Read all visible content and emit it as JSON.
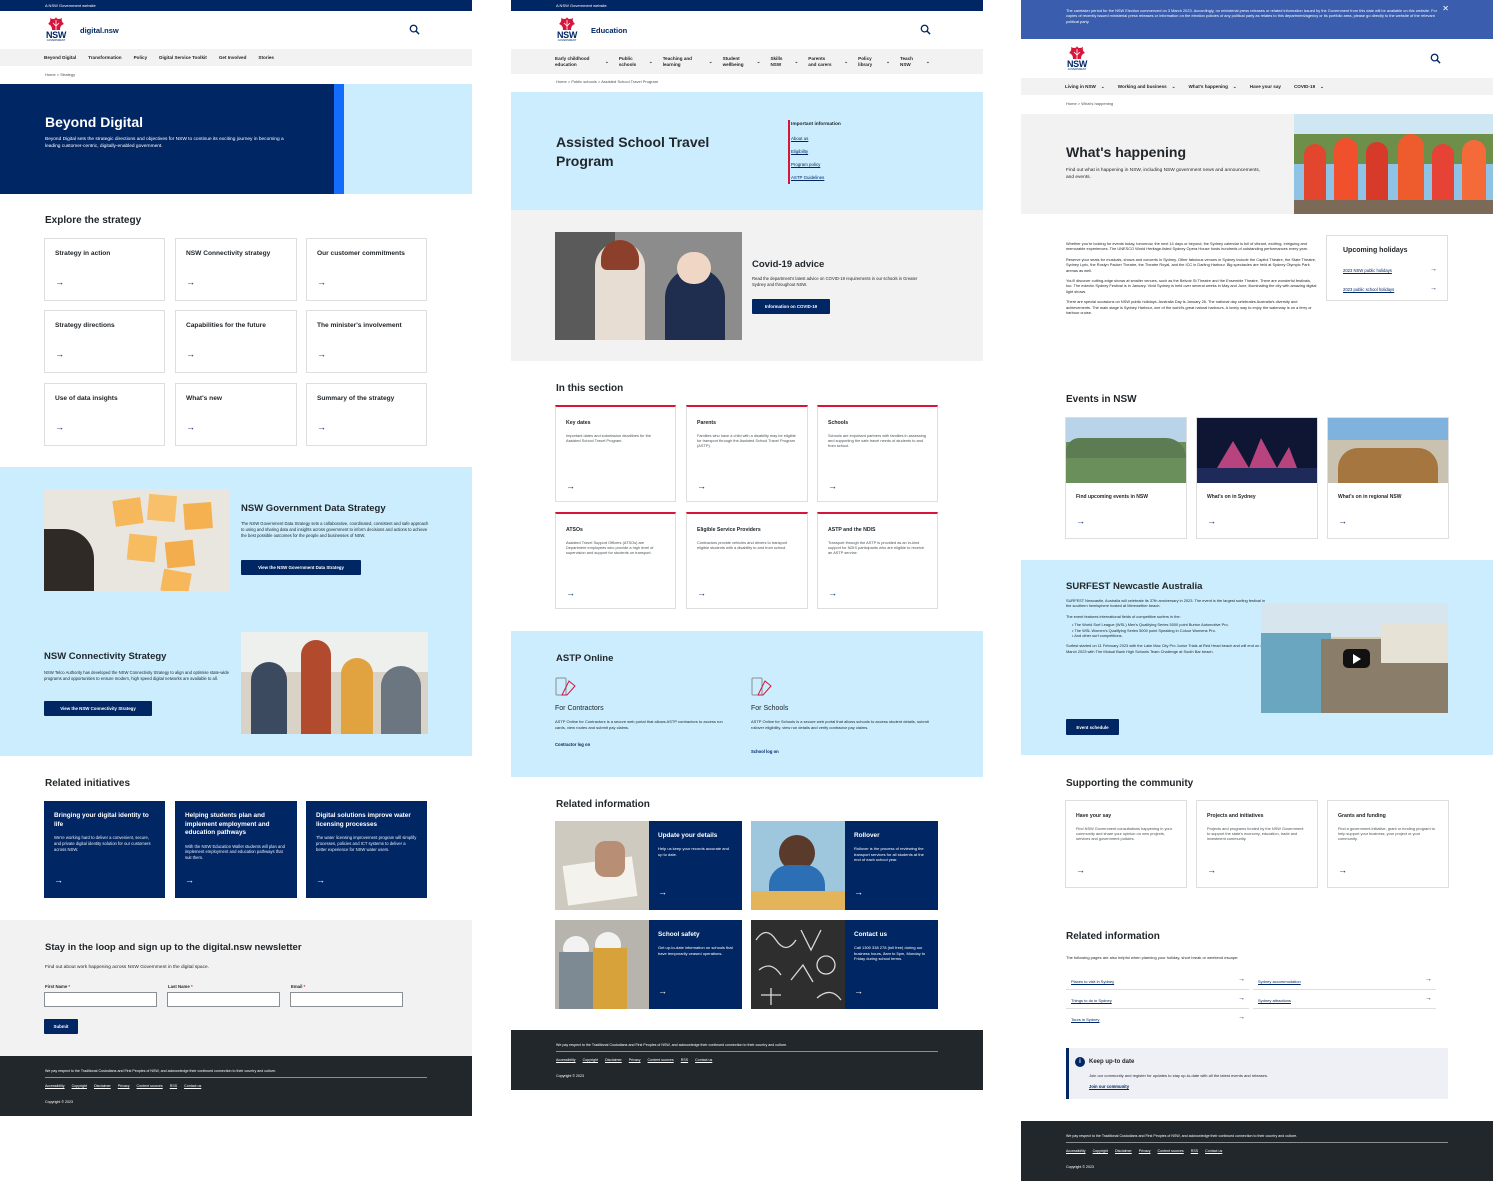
{
  "c1": {
    "masthead": "A NSW Government website",
    "logo": {
      "nsw": "NSW",
      "gov": "GOVERNMENT"
    },
    "site": "digital.nsw",
    "nav": [
      "Beyond Digital",
      "Transformation",
      "Policy",
      "Digital Service Toolkit",
      "Get Involved",
      "Stories"
    ],
    "crumb": "Home  >  Strategy",
    "hero": {
      "title": "Beyond Digital",
      "text": "Beyond Digital sets the strategic directions and objectives for NSW to continue its exciting journey in becoming a leading customer-centric, digitally-enabled government."
    },
    "explore_title": "Explore the strategy",
    "explore": [
      "Strategy in action",
      "NSW Connectivity strategy",
      "Our customer commitments",
      "Strategy directions",
      "Capabilities for the future",
      "The minister's involvement",
      "Use of data insights",
      "What's new",
      "Summary of the strategy"
    ],
    "data_strategy": {
      "title": "NSW Government Data Strategy",
      "text": "The NSW Government Data Strategy sets a collaborative, coordinated, consistent and safe approach to using and sharing data and insights across government to inform decisions and actions to achieve the best possible outcomes for the people and businesses of NSW.",
      "button": "View the NSW Government Data Strategy"
    },
    "connectivity": {
      "title": "NSW Connectivity Strategy",
      "text": "NSW Telco Authority has developed the NSW Connectivity Strategy to align and optimise state-wide programs and opportunities to ensure modern, high speed digital networks are available to all.",
      "button": "View the NSW Connectivity Strategy"
    },
    "related_title": "Related initiatives",
    "related": [
      {
        "title": "Bringing your digital identity to life",
        "text": "We're working hard to deliver a convenient, secure, and private digital identity solution for our customers across NSW."
      },
      {
        "title": "Helping students plan and implement employment and education pathways",
        "text": "With the NSW Education Wallet students will plan and implement employment and education pathways that suit them."
      },
      {
        "title": "Digital solutions improve water licensing processes",
        "text": "The water licensing improvement program will simplify processes, policies and ICT systems to deliver a better experience for NSW water users."
      }
    ],
    "newsletter": {
      "title": "Stay in the loop and sign up to the digital.nsw newsletter",
      "text": "Find out about work happening across NSW Government in the digital space.",
      "first": "First Name",
      "last": "Last Name",
      "email": "Email",
      "req": "*",
      "submit": "Submit"
    },
    "footer": {
      "ack": "We pay respect to the Traditional Custodians and First Peoples of NSW, and acknowledge their continued connection to their country and culture.",
      "links": [
        "Accessibility",
        "Copyright",
        "Disclaimer",
        "Privacy",
        "Content sources",
        "RSS",
        "Contact us"
      ],
      "copy": "Copyright © 2023"
    }
  },
  "c2": {
    "masthead": "A NSW Government website",
    "logo": {
      "nsw": "NSW",
      "gov": "GOVERNMENT"
    },
    "site": "Education",
    "nav": [
      "Early childhood education",
      "Public schools",
      "Teaching and learning",
      "Student wellbeing",
      "Skills NSW",
      "Parents and carers",
      "Policy library",
      "Teach NSW"
    ],
    "crumb": "Home  >  Public schools  >  Assisted School Travel Program",
    "hero": {
      "title": "Assisted School Travel Program",
      "info_title": "Important information",
      "info_links": [
        "About us",
        "Eligibility",
        "Program policy",
        "ASTP Guidelines"
      ]
    },
    "covid": {
      "title": "Covid-19 advice",
      "text": "Read the department's latest advice on COVID-19 requirements in our schools in Greater Sydney and throughout NSW.",
      "button": "Information on COVID-19"
    },
    "section_title": "In this section",
    "section": [
      {
        "title": "Key dates",
        "text": "Important dates and submission deadlines for the Assisted School Travel Program."
      },
      {
        "title": "Parents",
        "text": "Families who have a child with a disability may be eligible for transport through the Assisted School Travel Program (ASTP)."
      },
      {
        "title": "Schools",
        "text": "Schools are important partners with families in assessing and supporting the safe travel needs of students to and from school."
      },
      {
        "title": "ATSOs",
        "text": "Assisted Travel Support Officers (ATSOs) are Department employees who provide a high level of supervision and support for students on transport."
      },
      {
        "title": "Eligible Service Providers",
        "text": "Contractors provide vehicles and drivers to transport eligible students with a disability to and from school."
      },
      {
        "title": "ASTP and the NDIS",
        "text": "Transport through the ASTP is provided as an in-kind support for NDIS participants who are eligible to receive an ASTP service."
      }
    ],
    "astp": {
      "title": "ASTP Online",
      "a_title": "For Contractors",
      "a_text": "ASTP Online for Contractors is a secure web portal that allows ASTP contractors to access run cards, view routes and submit pay claims.",
      "a_link": "Contractor log on",
      "b_title": "For Schools",
      "b_text": "ASTP Online for Schools is a secure web portal that allows schools to access student details, submit rollover eligibility, view run details and verify contractor pay claims.",
      "b_link": "School log on"
    },
    "related_title": "Related information",
    "related": [
      {
        "title": "Update your details",
        "text": "Help us keep your records accurate and up to date."
      },
      {
        "title": "Rollover",
        "text": "Rollover is the process of reviewing the transport services for all students at the end of each school year."
      },
      {
        "title": "School safety",
        "text": "Get up-to-date information on schools that have temporarily ceased operations."
      },
      {
        "title": "Contact us",
        "text": "Call 1300 338 278 (toll free) during our business hours, 8am to 5pm, Monday to Friday during school terms."
      }
    ],
    "footer": {
      "ack": "We pay respect to the Traditional Custodians and First Peoples of NSW, and acknowledge their continued connection to their country and culture.",
      "links": [
        "Accessibility",
        "Copyright",
        "Disclaimer",
        "Privacy",
        "Content sources",
        "RSS",
        "Contact us"
      ],
      "copy": "Copyright © 2023"
    }
  },
  "c3": {
    "alert": "The caretaker period for the NSW Election commenced on 3 March 2023. Accordingly, no ministerial press releases or related information issued by the Government from this date will be available on this website. For copies of recently issued ministerial press releases or information on the election policies of any political party as relates to this department/agency or its portfolio area, please go directly to the website of the relevant political party.",
    "logo": {
      "nsw": "NSW",
      "gov": "GOVERNMENT"
    },
    "nav": [
      "Living in NSW",
      "Working and business",
      "What's happening",
      "Have your say",
      "COVID-19"
    ],
    "crumb": "Home  >  What's happening",
    "hero": {
      "title": "What's happening",
      "text": "Find out what is happening in NSW, including NSW government news and announcements, and events."
    },
    "intro": [
      "Whether you're looking for events today, tomorrow, the next 14 days or beyond, the Sydney calendar is full of vibrant, exciting, intriguing and memorable experiences. The UNESCO World Heritage-listed Sydney Opera House hosts hundreds of outstanding performances every year.",
      "Reserve your seats for musicals, shows and concerts in Sydney. Other fabulous venues in Sydney include the Capitol Theatre, the State Theatre, Sydney Lyric, the Roslyn Packer Theatre, the Theatre Royal, and the ICC in Darling Harbour. Big spectacles are held at Sydney Olympic Park arenas as well.",
      "You'll discover cutting-edge shows at smaller venues, such as the Belvoir St Theatre and the Ensemble Theatre. There are wonderful festivals, too. The eclectic Sydney Festival is in January. Vivid Sydney is held over several weeks in May and June, illuminating the city with amazing digital light shows.",
      "There are special occasions on NSW public holidays. Australia Day is January 26. The national day celebrates Australia's diversity and achievements. The main stage is Sydney Harbour, one of the world's great natural harbours. A lovely way to enjoy the waterway is on a ferry or harbour cruise."
    ],
    "holidays": {
      "title": "Upcoming holidays",
      "links": [
        "2023 NSW public holidays",
        "2023 public school holidays"
      ]
    },
    "events_title": "Events in NSW",
    "events": [
      "Find upcoming events in NSW",
      "What's on in Sydney",
      "What's on in regional NSW"
    ],
    "surf": {
      "title": "SURFEST Newcastle Australia",
      "p1": "SURFEST Newcastle, Australia will celebrate its 37th anniversary in 2023. The event is the largest surfing festival in the southern hemisphere hosted at Merewether beach.",
      "p2": "The event features international fields of competitive surfers in the:",
      "bullets": [
        "The World Surf League (WSL) Men's Qualifying Series 5000 point Burton Automotive Pro.",
        "The WSL Women's Qualifying Series 5000 point Speaking in Colour Womens Pro.",
        "And other surf competitions."
      ],
      "p3": "Surfest started on 11 February 2023 with the Lake Mac City Pro Junior Trials at Red Head beach and will end on 24 March 2023 with The Mutual Bank High Schools Team Challenge at South Bar beach.",
      "button": "Event schedule"
    },
    "community_title": "Supporting the community",
    "community": [
      {
        "title": "Have your say",
        "text": "Find NSW Government consultations happening in your community and share your opinion on new projects, services and government policies."
      },
      {
        "title": "Projects and initiatives",
        "text": "Projects and programs funded by the NSW Government to support the state's economy, education, trade and investment community."
      },
      {
        "title": "Grants and funding",
        "text": "Find a government initiative, grant or funding program to help support your business, your project or your community."
      }
    ],
    "related_title": "Related information",
    "related_text": "The following pages are also helpful when planning your holiday, short break or weekend escape:",
    "related_links": [
      "Places to visit in Sydney",
      "Sydney accommodation",
      "Things to do in Sydney",
      "Sydney attractions",
      "Tours in Sydney"
    ],
    "keep": {
      "title": "Keep up-to date",
      "text": "Join our community and register for updates to stay up-to-date with all the latest events and releases.",
      "link": "Join our community"
    },
    "footer": {
      "ack": "We pay respect to the Traditional Custodians and First Peoples of NSW, and acknowledge their continued connection to their country and culture.",
      "links": [
        "Accessibility",
        "Copyright",
        "Disclaimer",
        "Privacy",
        "Content sources",
        "RSS",
        "Contact us"
      ],
      "copy": "Copyright © 2023"
    }
  }
}
